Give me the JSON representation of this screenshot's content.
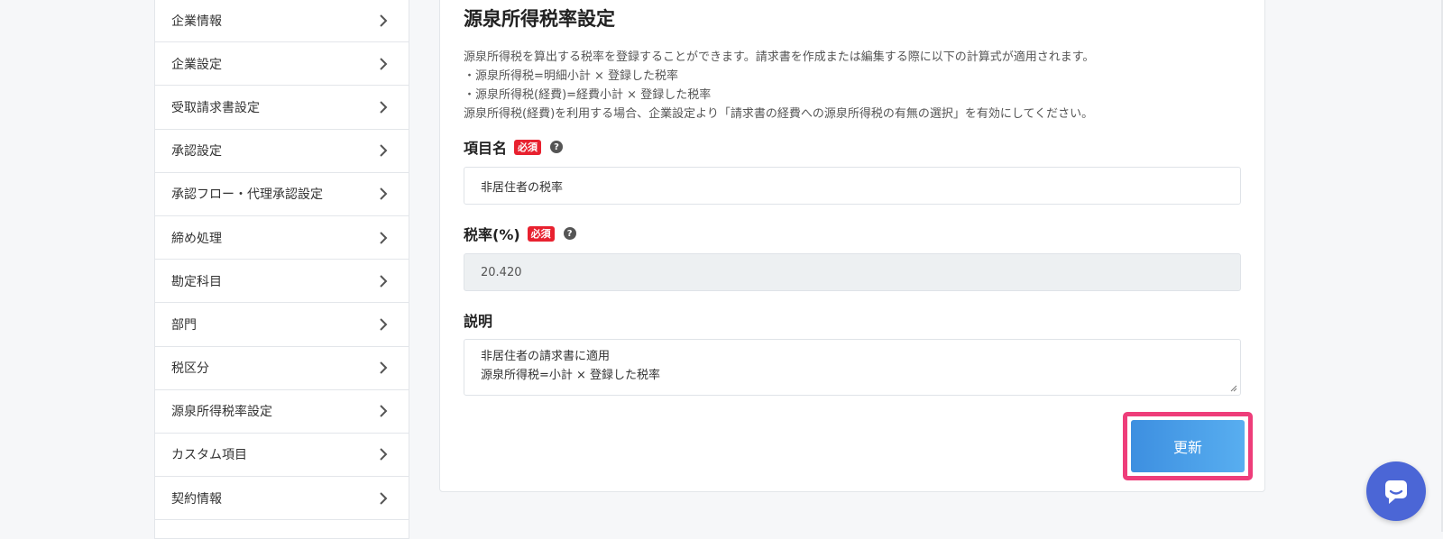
{
  "sidebar": {
    "items": [
      {
        "label": "企業情報"
      },
      {
        "label": "企業設定"
      },
      {
        "label": "受取請求書設定"
      },
      {
        "label": "承認設定"
      },
      {
        "label": "承認フロー・代理承認設定"
      },
      {
        "label": "締め処理"
      },
      {
        "label": "勘定科目"
      },
      {
        "label": "部門"
      },
      {
        "label": "税区分"
      },
      {
        "label": "源泉所得税率設定"
      },
      {
        "label": "カスタム項目"
      },
      {
        "label": "契約情報"
      }
    ]
  },
  "main": {
    "title": "源泉所得税率設定",
    "description": [
      "源泉所得税を算出する税率を登録することができます。請求書を作成または編集する際に以下の計算式が適用されます。",
      "・源泉所得税=明細小計 × 登録した税率",
      "・源泉所得税(経費)=経費小計 × 登録した税率",
      "源泉所得税(経費)を利用する場合、企業設定より「請求書の経費への源泉所得税の有無の選択」を有効にしてください。"
    ],
    "item_name": {
      "label": "項目名",
      "required": "必須",
      "value": "非居住者の税率"
    },
    "tax_rate": {
      "label": "税率(%)",
      "required": "必須",
      "value": "20.420"
    },
    "description_field": {
      "label": "説明",
      "value": "非居住者の請求書に適用\n源泉所得税=小計 × 登録した税率"
    },
    "update_label": "更新"
  },
  "colors": {
    "required_badge": "#e8212f",
    "update_button": "#4a9fe8",
    "highlight_border": "#ee3d7a",
    "chat_widget": "#4b66d6"
  },
  "icons": {
    "sidebar_chevron": "chevron-right-icon",
    "help": "question-circle-icon",
    "chat": "chat-bubble-icon"
  }
}
